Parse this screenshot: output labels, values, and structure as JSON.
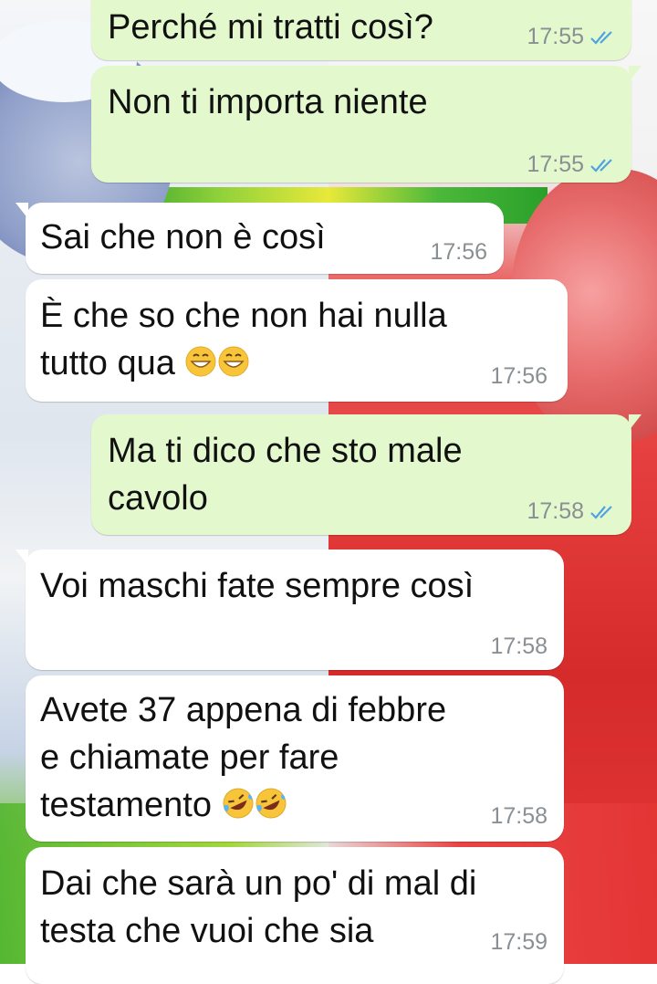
{
  "colors": {
    "outgoing_bubble": "#e3f9cd",
    "incoming_bubble": "#ffffff",
    "read_ticks": "#4fa3e0",
    "timestamp": "#8a8f93"
  },
  "messages": [
    {
      "direction": "outgoing",
      "text": "Perché mi tratti così?",
      "time": "17:55",
      "status": "read-ticks-icon"
    },
    {
      "direction": "outgoing",
      "text": "Non ti importa niente",
      "time": "17:55",
      "status": "read-ticks-icon"
    },
    {
      "direction": "incoming",
      "text": "Sai che non è così",
      "time": "17:56"
    },
    {
      "direction": "incoming",
      "lines": [
        "È che so che non hai nulla",
        "tutto qua"
      ],
      "emoji": "grinning-face-icon",
      "time": "17:56"
    },
    {
      "direction": "outgoing",
      "lines": [
        "Ma ti dico che sto male",
        "cavolo"
      ],
      "time": "17:58",
      "status": "read-ticks-icon"
    },
    {
      "direction": "incoming",
      "text": "Voi maschi fate sempre così",
      "time": "17:58"
    },
    {
      "direction": "incoming",
      "lines": [
        "Avete 37 appena di febbre",
        "e chiamate per fare",
        "testamento"
      ],
      "emoji": "rolling-on-floor-laughing-icon",
      "time": "17:58"
    },
    {
      "direction": "incoming",
      "lines": [
        "Dai che sarà un po' di mal di",
        "testa che vuoi che sia"
      ],
      "time": "17:59"
    }
  ]
}
